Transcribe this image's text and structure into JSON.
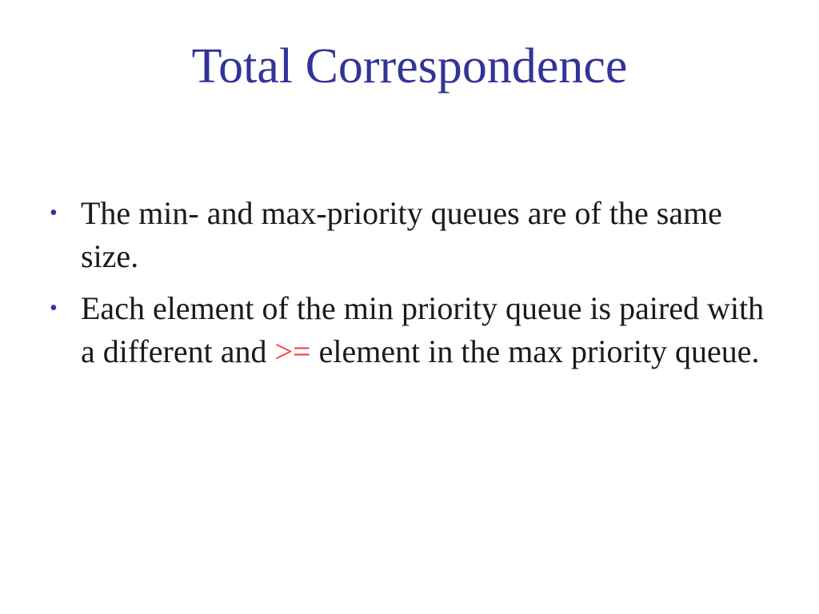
{
  "slide": {
    "title": "Total Correspondence",
    "bullet_marker": "•",
    "bullets": [
      {
        "text": "The min- and max-priority queues are of the same size."
      },
      {
        "text_before": "Each element of the min priority queue is paired with a different and ",
        "highlight": ">=",
        "text_after": " element in the max priority queue."
      }
    ]
  },
  "colors": {
    "title": "#333399",
    "bullet_marker": "#333399",
    "body_text": "#1a1a1a",
    "highlight": "#ff3333",
    "background": "#ffffff"
  }
}
